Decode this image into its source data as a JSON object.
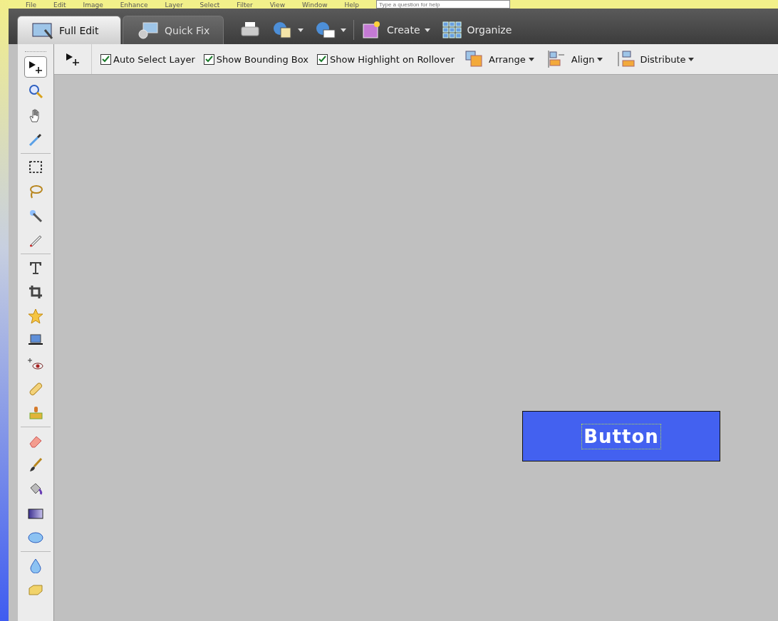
{
  "menu_bar": {
    "items": [
      "File",
      "Edit",
      "Image",
      "Enhance",
      "Layer",
      "Select",
      "Filter",
      "View",
      "Window",
      "Help"
    ],
    "help_field": {
      "placeholder": "Type a question for help"
    }
  },
  "mode_tabs": [
    {
      "label": "Full Edit",
      "kind": "full",
      "selected": true
    },
    {
      "label": "Quick Fix",
      "kind": "quick",
      "selected": false
    }
  ],
  "actions": [
    {
      "kind": "print",
      "dropdown": false
    },
    {
      "kind": "share",
      "dropdown": true
    },
    {
      "kind": "email",
      "dropdown": true
    },
    {
      "kind": "create",
      "label": "Create",
      "dropdown": true
    },
    {
      "kind": "organize",
      "label": "Organize",
      "dropdown": false
    }
  ],
  "options_bar": {
    "checkboxes": [
      {
        "label": "Auto Select Layer",
        "checked": true
      },
      {
        "label": "Show Bounding Box",
        "checked": true
      },
      {
        "label": "Show Highlight on Rollover",
        "checked": true
      }
    ],
    "menus": [
      {
        "kind": "arrange",
        "label": "Arrange"
      },
      {
        "kind": "align",
        "label": "Align"
      },
      {
        "kind": "distribute",
        "label": "Distribute"
      }
    ]
  },
  "toolbox": {
    "groups": [
      [
        {
          "kind": "move",
          "selected": true
        },
        {
          "kind": "zoom",
          "selected": false
        },
        {
          "kind": "hand",
          "selected": false
        },
        {
          "kind": "eyedropper",
          "selected": false
        }
      ],
      [
        {
          "kind": "marquee",
          "selected": false
        },
        {
          "kind": "lasso",
          "selected": false
        },
        {
          "kind": "wand",
          "selected": false
        },
        {
          "kind": "pencil",
          "selected": false
        }
      ],
      [
        {
          "kind": "type",
          "selected": false
        },
        {
          "kind": "crop",
          "selected": false
        },
        {
          "kind": "star",
          "selected": false
        },
        {
          "kind": "straighten",
          "selected": false
        },
        {
          "kind": "redeye",
          "selected": false
        },
        {
          "kind": "bandage",
          "selected": false
        },
        {
          "kind": "stamp",
          "selected": false
        }
      ],
      [
        {
          "kind": "eraser",
          "selected": false
        },
        {
          "kind": "brush",
          "selected": false
        },
        {
          "kind": "bucket",
          "selected": false
        },
        {
          "kind": "gradient",
          "selected": false
        },
        {
          "kind": "ellipse",
          "selected": false
        }
      ],
      [
        {
          "kind": "drop",
          "selected": false
        },
        {
          "kind": "sponge",
          "selected": false
        }
      ]
    ]
  },
  "canvas": {
    "layer": {
      "text": "Button",
      "color": "#4361f0",
      "selected": true
    }
  }
}
